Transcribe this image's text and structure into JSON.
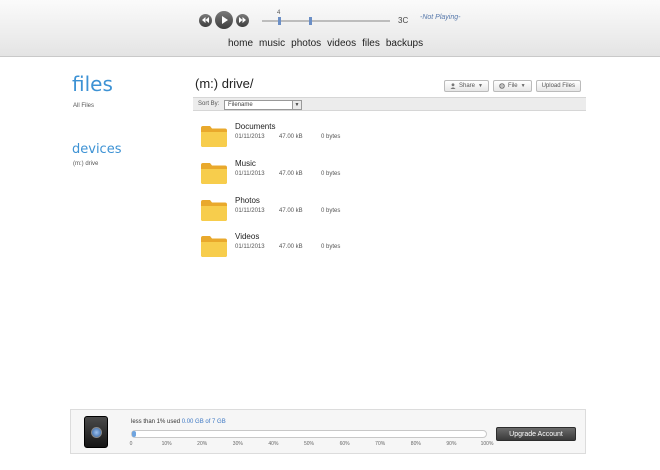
{
  "player": {
    "controls": [
      "prev",
      "play",
      "next"
    ],
    "progress": 0.13,
    "volume_marker": "4",
    "time": "3C",
    "now_playing": "-Not Playing-"
  },
  "nav": [
    {
      "label": "home"
    },
    {
      "label": "music"
    },
    {
      "label": "photos"
    },
    {
      "label": "videos"
    },
    {
      "label": "files"
    },
    {
      "label": "backups"
    }
  ],
  "sidebar": {
    "files_title": "files",
    "files_sub": "All Files",
    "devices_title": "devices",
    "devices_sub": "(m:) drive"
  },
  "main": {
    "breadcrumb": "(m:) drive/",
    "buttons": [
      {
        "label": "Share",
        "icon": "user-icon",
        "caret": true
      },
      {
        "label": "File",
        "icon": "gear-icon",
        "caret": true
      },
      {
        "label": "Upload Files",
        "icon": "",
        "caret": false
      }
    ],
    "sort_label": "Sort By:",
    "sort_value": "Filename"
  },
  "files": [
    {
      "name": "Documents",
      "date": "01/11/2013",
      "size": "47.00 kB",
      "kb": "0 bytes"
    },
    {
      "name": "Music",
      "date": "01/11/2013",
      "size": "47.00 kB",
      "kb": "0 bytes"
    },
    {
      "name": "Photos",
      "date": "01/11/2013",
      "size": "47.00 kB",
      "kb": "0 bytes"
    },
    {
      "name": "Videos",
      "date": "01/11/2013",
      "size": "47.00 kB",
      "kb": "0 bytes"
    }
  ],
  "storage": {
    "label_prefix": "less than 1% used",
    "label_amount": "0.00 GB of 7 GB",
    "used_fraction": 0.01,
    "ticks": [
      "0",
      "10%",
      "20%",
      "30%",
      "40%",
      "50%",
      "60%",
      "70%",
      "80%",
      "90%",
      "100%"
    ],
    "upgrade_label": "Upgrade Account"
  },
  "colors": {
    "accent": "#3d92d4",
    "fill": "#6fa4df"
  }
}
